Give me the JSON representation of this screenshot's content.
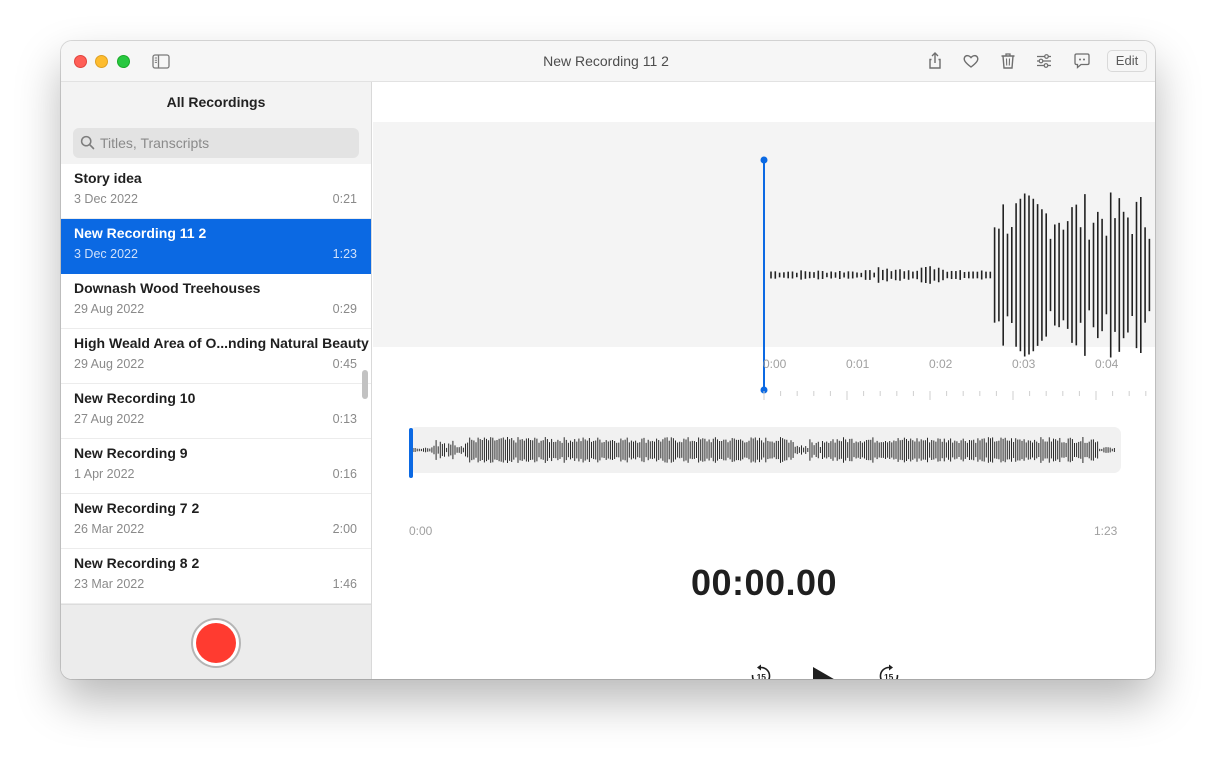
{
  "window": {
    "title": "New Recording 11 2",
    "edit_label": "Edit",
    "toolbar_icons": [
      "share-icon",
      "heart-icon",
      "trash-icon",
      "sliders-icon",
      "transcript-icon"
    ]
  },
  "sidebar": {
    "title": "All Recordings",
    "search_placeholder": "Titles, Transcripts",
    "recordings": [
      {
        "title": "Story idea",
        "date": "3 Dec 2022",
        "duration": "0:21",
        "selected": false
      },
      {
        "title": "New Recording 11 2",
        "date": "3 Dec 2022",
        "duration": "1:23",
        "selected": true
      },
      {
        "title": "Downash Wood Treehouses",
        "date": "29 Aug 2022",
        "duration": "0:29",
        "selected": false
      },
      {
        "title": "High Weald Area of O...nding Natural Beauty",
        "date": "29 Aug 2022",
        "duration": "0:45",
        "selected": false
      },
      {
        "title": "New Recording 10",
        "date": "27 Aug 2022",
        "duration": "0:13",
        "selected": false
      },
      {
        "title": "New Recording 9",
        "date": "1 Apr 2022",
        "duration": "0:16",
        "selected": false
      },
      {
        "title": "New Recording 7 2",
        "date": "26 Mar 2022",
        "duration": "2:00",
        "selected": false
      },
      {
        "title": "New Recording 8 2",
        "date": "23 Mar 2022",
        "duration": "1:46",
        "selected": false
      }
    ]
  },
  "player": {
    "timeline_ticks": [
      "0:00",
      "0:01",
      "0:02",
      "0:03",
      "0:04"
    ],
    "overview_start": "0:00",
    "overview_end": "1:23",
    "time_display": "00:00.00",
    "skip_back_label": "15",
    "skip_forward_label": "15",
    "playhead_position": 0,
    "accent_color": "#0b69e3",
    "record_color": "#ff3b30"
  }
}
